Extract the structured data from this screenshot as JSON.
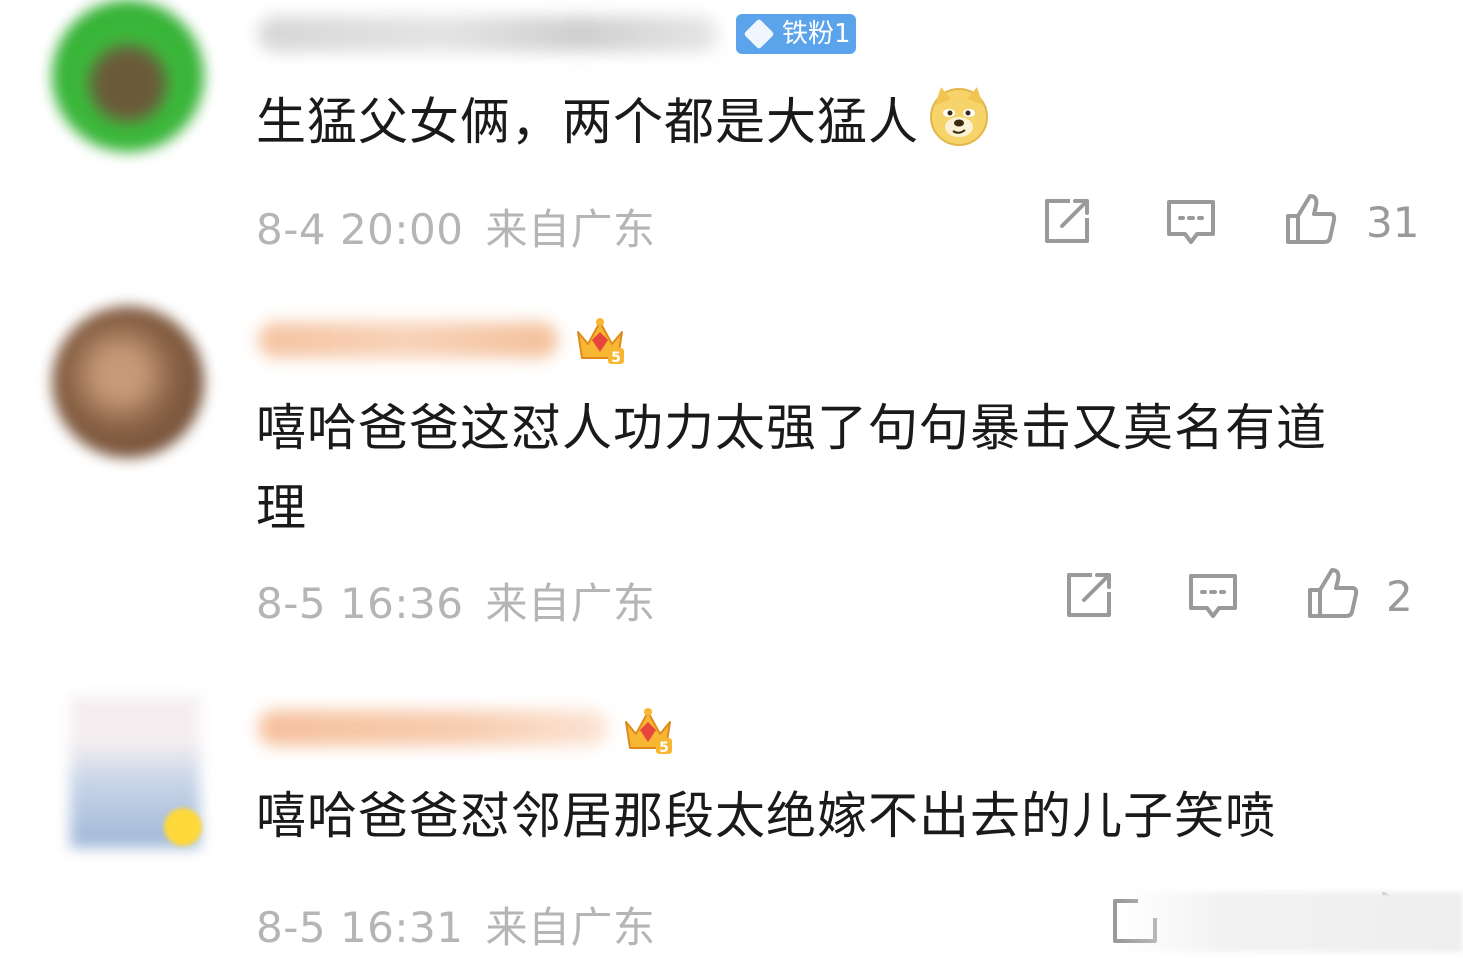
{
  "comments": [
    {
      "badge_label": "铁粉1",
      "text": "生猛父女俩，两个都是大猛人",
      "emoji_icon": "doge-emoji-icon",
      "date": "8-4 20:00",
      "location": "来自广东",
      "likes": "31",
      "avatar_color": "#3cba3c"
    },
    {
      "crown_level": "5",
      "text_line1": "嘻哈爸爸这怼人功力太强了句句暴击又莫名有道",
      "text_line2": "理",
      "date": "8-5 16:36",
      "location": "来自广东",
      "likes": "2",
      "avatar_color": "#8a6246"
    },
    {
      "crown_level": "5",
      "text": "嘻哈爸爸怼邻居那段太绝嫁不出去的儿子笑喷",
      "date": "8-5 16:31",
      "location": "来自广东",
      "avatar_color": "#c9d6e8"
    }
  ],
  "icons": {
    "share": "share-icon",
    "comment": "comment-icon",
    "like": "thumbs-up-icon",
    "crown": "vip-crown-icon",
    "badge": "diamond-icon"
  },
  "colors": {
    "badge_blue": "#5ba4ec",
    "meta_gray": "#b5b5b5",
    "name_blur_gray": "#d8d8d8",
    "name_blur_orange": "#f7c9a8"
  }
}
